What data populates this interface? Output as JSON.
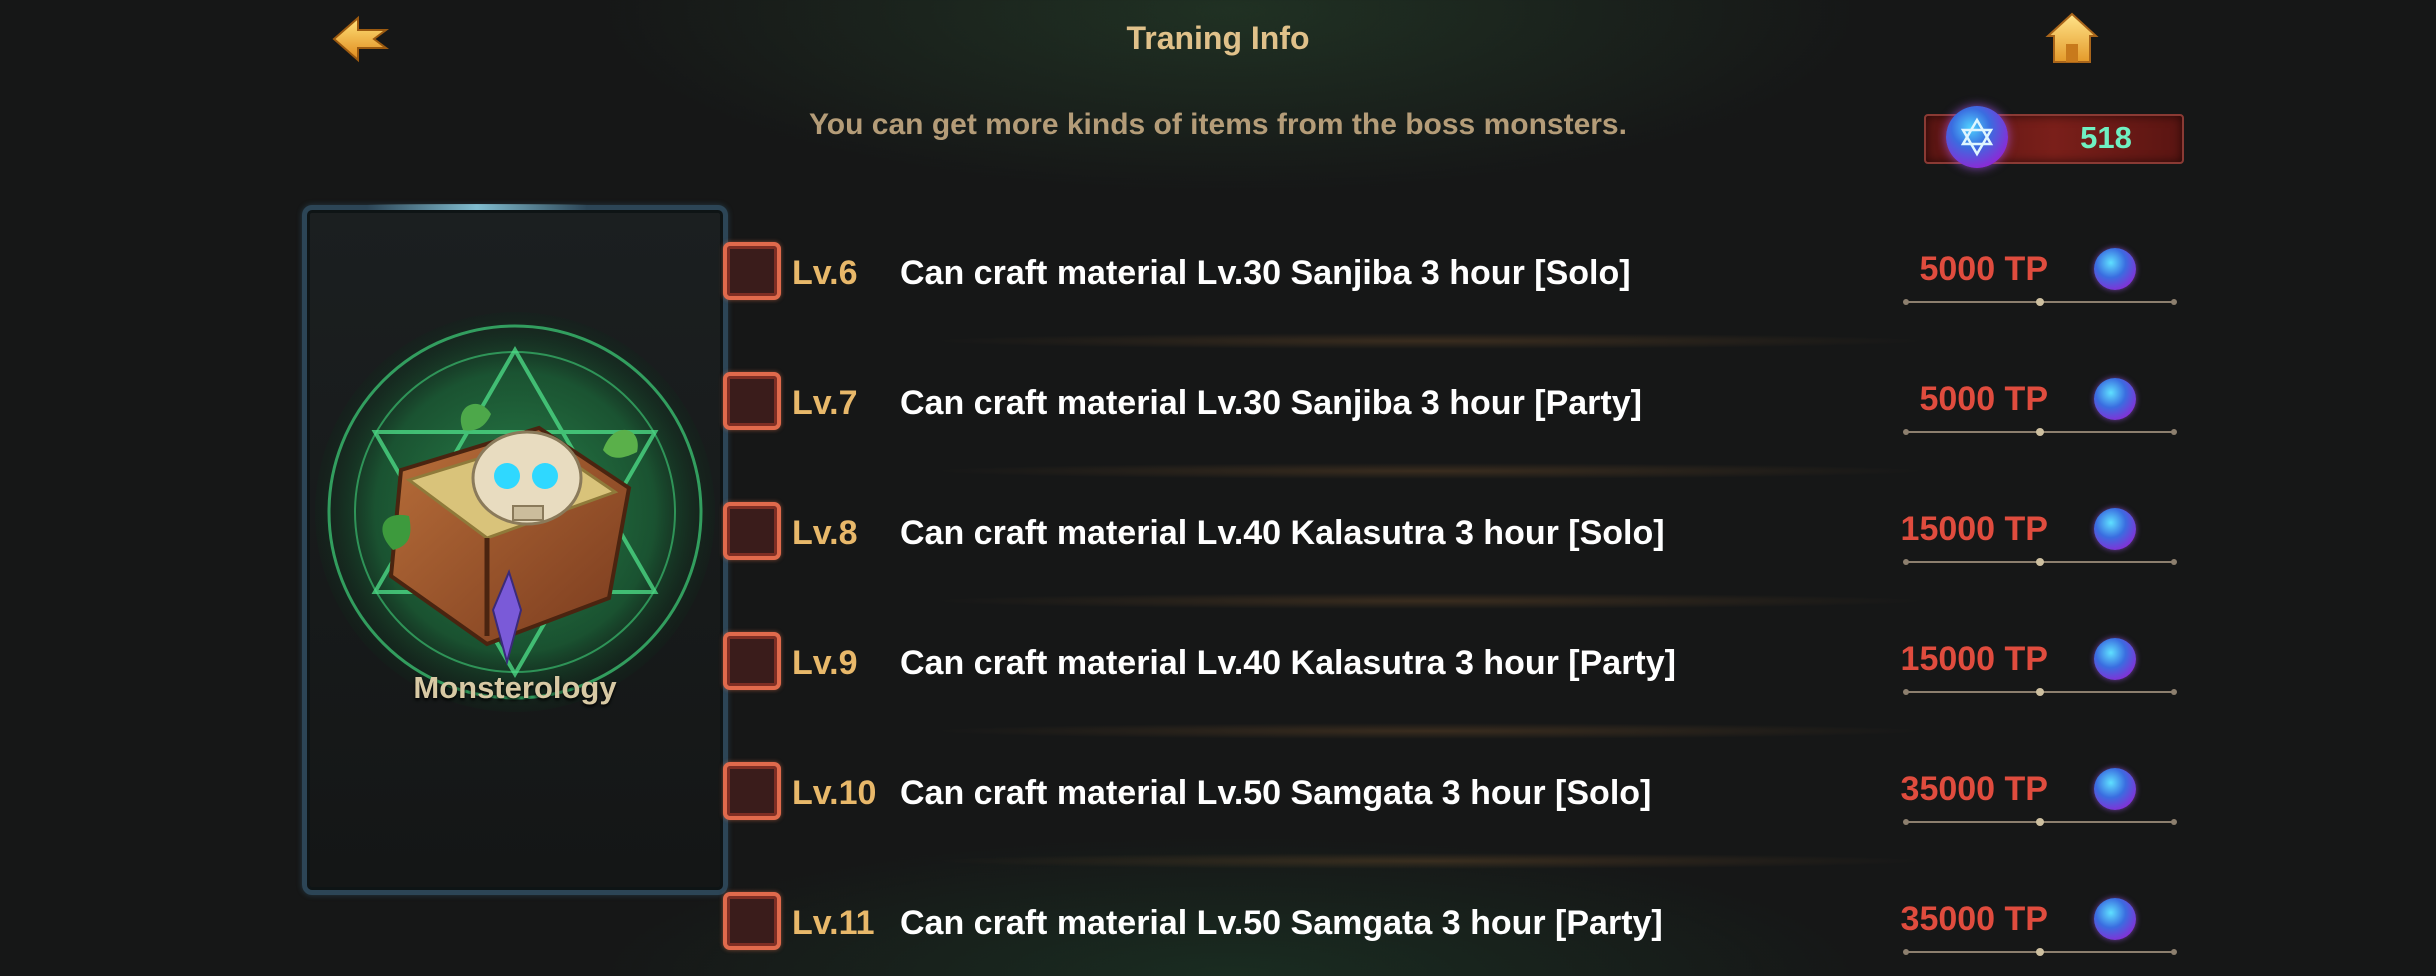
{
  "header": {
    "title": "Traning Info",
    "subtitle": "You can get more kinds of items from the boss monsters."
  },
  "currency": {
    "amount": "518",
    "icon": "hexagram-orb-icon"
  },
  "card": {
    "name": "Monsterology",
    "icon": "skull-book-icon"
  },
  "training_list": [
    {
      "level": "Lv.6",
      "description": "Can craft material Lv.30 Sanjiba 3 hour [Solo]",
      "cost": "5000 TP"
    },
    {
      "level": "Lv.7",
      "description": "Can craft material Lv.30 Sanjiba 3 hour [Party]",
      "cost": "5000 TP"
    },
    {
      "level": "Lv.8",
      "description": "Can craft material Lv.40 Kalasutra 3 hour [Solo]",
      "cost": "15000 TP"
    },
    {
      "level": "Lv.9",
      "description": "Can craft material Lv.40 Kalasutra 3 hour [Party]",
      "cost": "15000 TP"
    },
    {
      "level": "Lv.10",
      "description": "Can craft material Lv.50 Samgata 3 hour [Solo]",
      "cost": "35000 TP"
    },
    {
      "level": "Lv.11",
      "description": "Can craft material Lv.50 Samgata 3 hour [Party]",
      "cost": "35000 TP"
    }
  ],
  "colors": {
    "title": "#e0c18a",
    "level": "#e8b86a",
    "cost": "#e04c3e",
    "currency_amount": "#6ff0c2"
  }
}
